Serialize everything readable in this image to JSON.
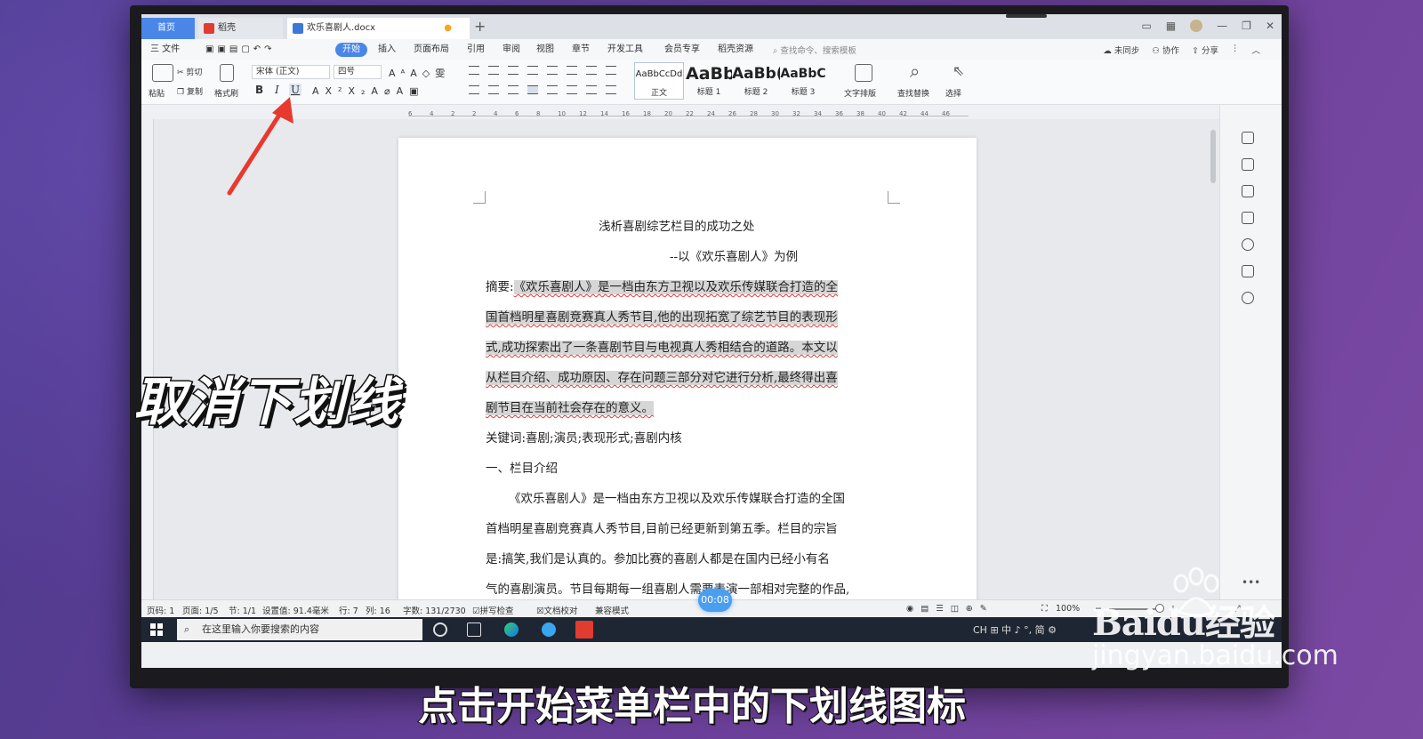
{
  "tabs": {
    "home": "首页",
    "docer": "稻壳",
    "doc": "欢乐喜剧人.docx",
    "new": "+"
  },
  "menu": {
    "file": "三 文件",
    "items": [
      "开始",
      "插入",
      "页面布局",
      "引用",
      "审阅",
      "视图",
      "章节",
      "开发工具",
      "会员专享",
      "稻壳资源"
    ],
    "search": "查找命令、搜索模板",
    "sync": "未同步",
    "collab": "协作",
    "share": "分享"
  },
  "ribbon": {
    "paste": "粘贴",
    "cut": "剪切",
    "copy": "复制",
    "format_painter": "格式刷",
    "font": "宋体 (正文)",
    "size": "四号",
    "bold": "B",
    "italic": "I",
    "underline": "U",
    "styles": [
      {
        "preview": "AaBbCcDd",
        "name": "正文"
      },
      {
        "preview": "AaBb",
        "name": "标题 1"
      },
      {
        "preview": "AaBb(",
        "name": "标题 2"
      },
      {
        "preview": "AaBbC",
        "name": "标题 3"
      }
    ],
    "text_layout": "文字排版",
    "find_replace": "查找替换",
    "select": "选择"
  },
  "ruler_ticks": [
    "6",
    "4",
    "2",
    "2",
    "4",
    "6",
    "8",
    "10",
    "12",
    "14",
    "16",
    "18",
    "20",
    "22",
    "24",
    "26",
    "28",
    "30",
    "32",
    "34",
    "36",
    "38",
    "40",
    "42",
    "44",
    "46"
  ],
  "document": {
    "title": "浅析喜剧综艺栏目的成功之处",
    "subtitle": "--以《欢乐喜剧人》为例",
    "abstract_label": "摘要:",
    "abstract_lines": [
      "《欢乐喜剧人》是一档由东方卫视以及欢乐传媒联合打造的全",
      "国首档明星喜剧竞赛真人秀节目,他的出现拓宽了综艺节目的表现形",
      "式,成功探索出了一条喜剧节目与电视真人秀相结合的道路。本文以",
      "从栏目介绍、成功原因、存在问题三部分对它进行分析,最终得出喜",
      "剧节目在当前社会存在的意义。"
    ],
    "keywords": "关键词:喜剧;演员;表现形式;喜剧内核",
    "section1": "一、栏目介绍",
    "body_lines": [
      "《欢乐喜剧人》是一档由东方卫视以及欢乐传媒联合打造的全国",
      "首档明星喜剧竞赛真人秀节目,目前已经更新到第五季。栏目的宗旨",
      "是:搞笑,我们是认真的。参加比赛的喜剧人都是在国内已经小有名",
      "气的喜剧演员。节目每期每一组喜剧人需要表演一部相对完整的作品,"
    ]
  },
  "status": {
    "page_code": "页码: 1",
    "pages": "页面: 1/5",
    "section": "节: 1/1",
    "setting": "设置值: 91.4毫米",
    "row": "行: 7",
    "col": "列: 16",
    "words": "字数: 131/2730",
    "spell": "拼写检查",
    "proof": "文档校对",
    "compat": "兼容模式",
    "zoom": "100%"
  },
  "taskbar": {
    "search_placeholder": "在这里输入你要搜索的内容",
    "tray": "CH ⊞ 中 ♪ °, 简 ⚙"
  },
  "overlay": {
    "title": "取消下划线",
    "timer": "00:08",
    "subtitle": "点击开始菜单栏中的下划线图标"
  },
  "watermark": {
    "logo": "Baidu经验",
    "url": "jingyan.baidu.com"
  },
  "colors": {
    "accent": "#4a86e8",
    "highlight": "#d6d6d6",
    "squiggle": "#e53935",
    "arrow": "#e8392f"
  }
}
